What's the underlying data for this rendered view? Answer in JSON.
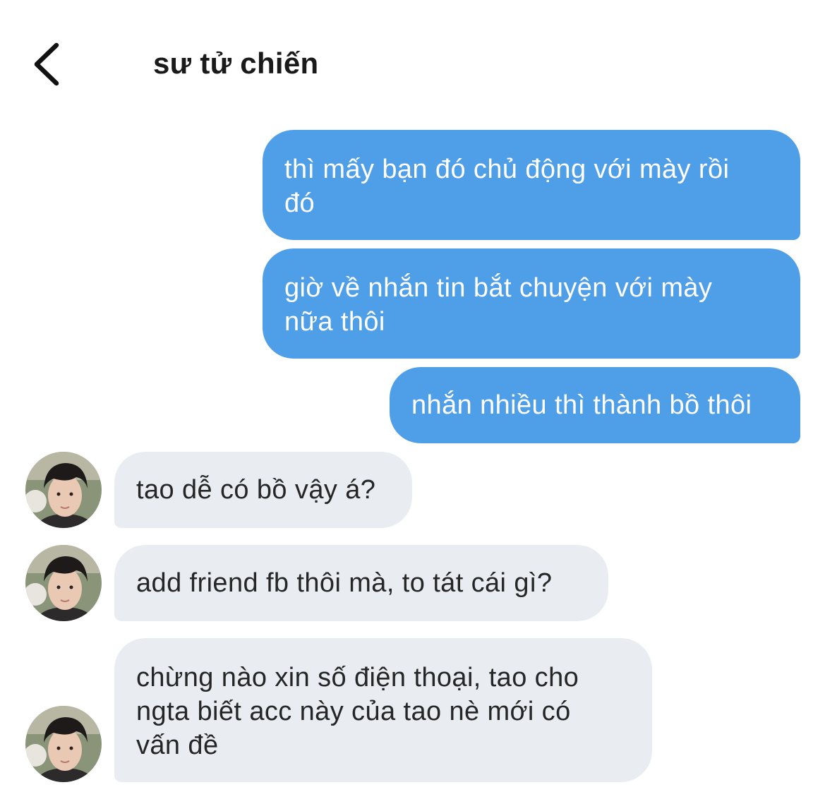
{
  "header": {
    "back_icon": "chevron-left-icon",
    "title": "sư tử chiến"
  },
  "colors": {
    "outgoing_bubble": "#4f9ee8",
    "incoming_bubble": "#e9edf1",
    "background": "#ffffff"
  },
  "messages": [
    {
      "direction": "outgoing",
      "text": "thì mấy bạn đó chủ động với mày rồi\nđó"
    },
    {
      "direction": "outgoing",
      "text": "giờ về nhắn tin bắt chuyện với mày\nnữa thôi"
    },
    {
      "direction": "outgoing",
      "text": "nhắn nhiều thì thành bồ thôi"
    },
    {
      "direction": "incoming",
      "text": "tao dễ có bồ vậy á?"
    },
    {
      "direction": "incoming",
      "text": "add friend fb thôi mà, to tát cái gì?"
    },
    {
      "direction": "incoming",
      "text": "chừng nào xin số điện thoại, tao cho\nngta biết acc này của tao nè mới có\nvấn đề"
    }
  ]
}
